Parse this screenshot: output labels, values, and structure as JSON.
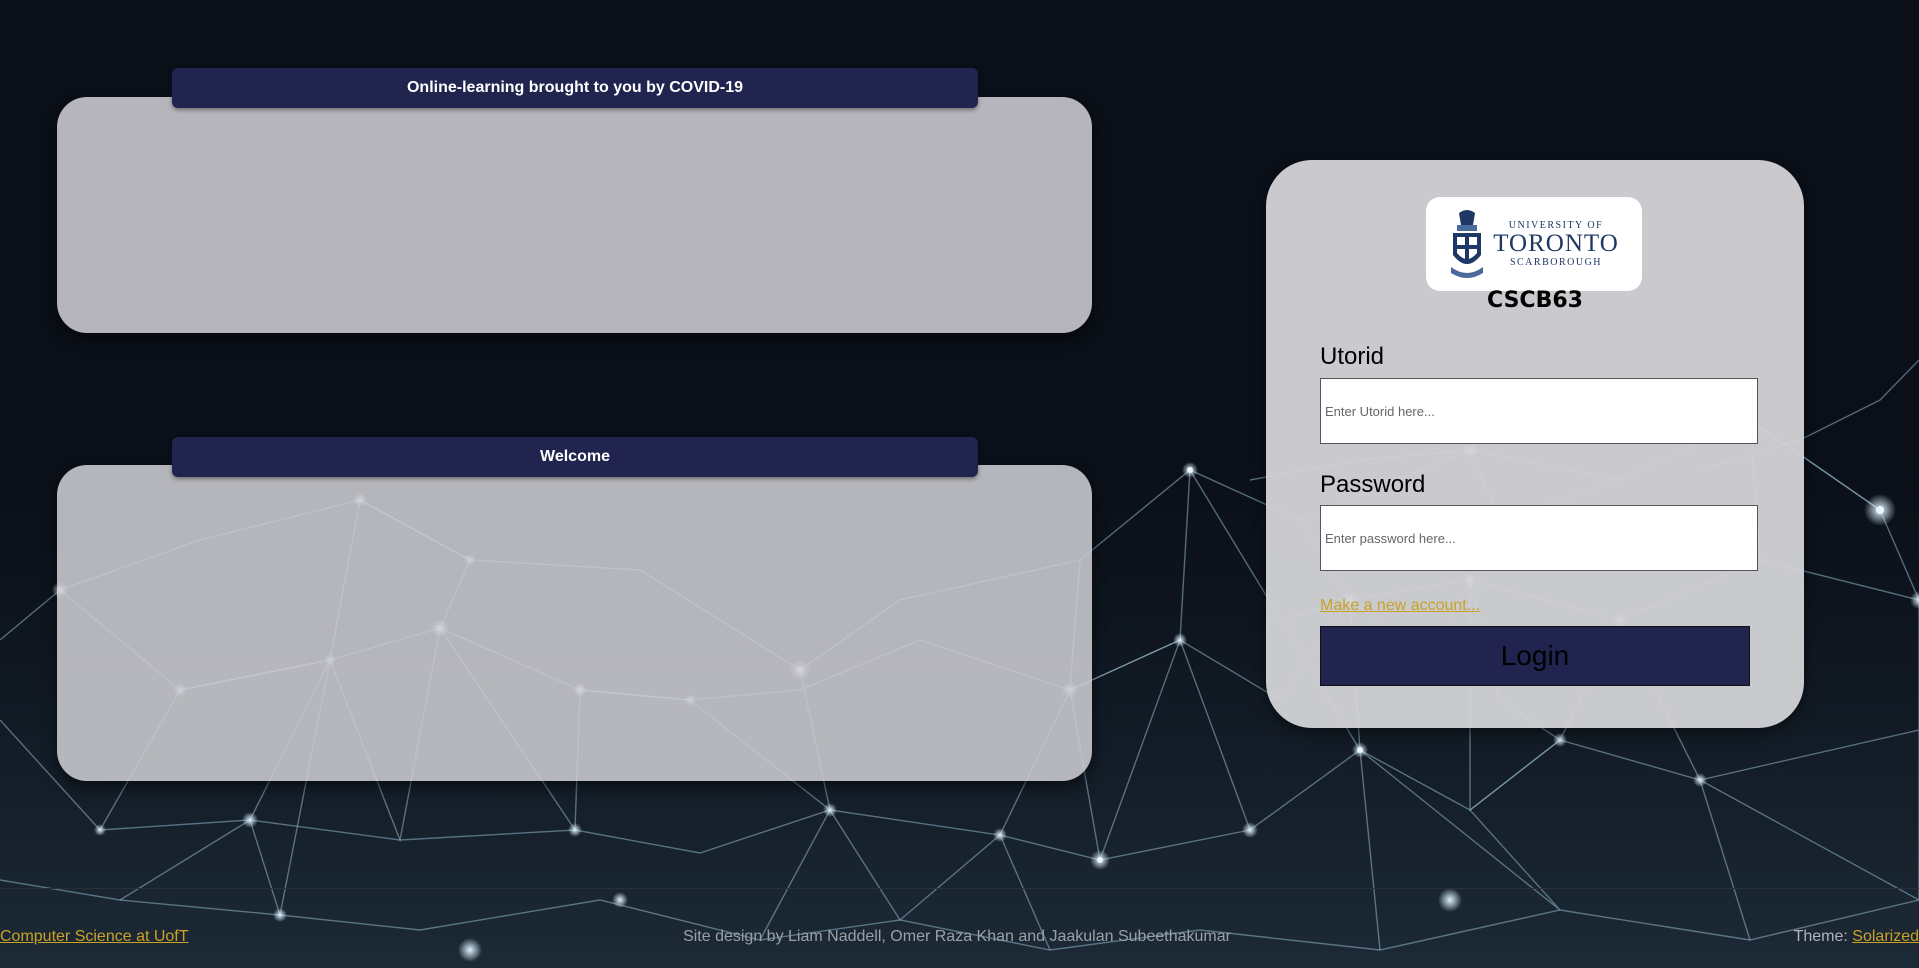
{
  "panels": {
    "top": {
      "header": "Online-learning brought to you by COVID-19"
    },
    "bottom": {
      "header": "Welcome"
    }
  },
  "login": {
    "logo": {
      "line1": "UNIVERSITY OF",
      "line2": "TORONTO",
      "line3": "SCARBOROUGH",
      "icon": "university-crest-icon"
    },
    "course": "CSCB63",
    "utorid_label": "Utorid",
    "utorid_placeholder": "Enter Utorid here...",
    "password_label": "Password",
    "password_placeholder": "Enter password here...",
    "new_account_link": "Make a new account...",
    "login_button": "Login"
  },
  "footer": {
    "left_link": "Computer Science at UofT",
    "credits": "Site design by Liam Naddell, Omer Raza Khan and Jaakulan Subeethakumar",
    "theme_label": "Theme: ",
    "theme_link": "Solarized"
  },
  "colors": {
    "background": "#0a0f18",
    "header_bar": "#21244f",
    "link": "#c9a227",
    "network_lines": "#8fb4c8"
  }
}
